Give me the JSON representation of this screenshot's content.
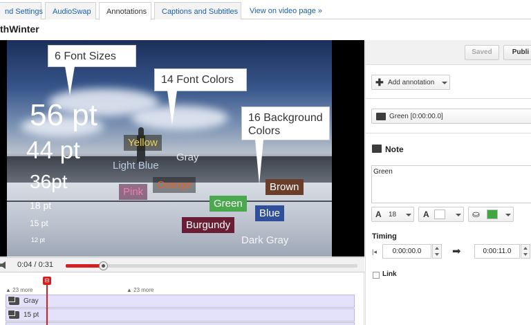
{
  "tabs": [
    {
      "label": "nd Settings"
    },
    {
      "label": "AudioSwap"
    },
    {
      "label": "Annotations"
    },
    {
      "label": "Captions and Subtitles"
    },
    {
      "label": "View on video page »"
    }
  ],
  "video_title": "thWinter",
  "video": {
    "callouts": {
      "font_sizes": "6 Font Sizes",
      "font_colors": "14 Font Colors",
      "background_colors": "16 Background Colors"
    },
    "sizes": [
      "56 pt",
      "44 pt",
      "36pt",
      "18 pt",
      "15 pt",
      "12 pt"
    ],
    "colors": {
      "yellow": "Yellow",
      "gray": "Gray",
      "light_blue": "Light Blue",
      "orange": "Orange",
      "pink": "Pink",
      "green": "Green",
      "brown": "Brown",
      "blue": "Blue",
      "burgundy": "Burgundy",
      "dark_gray": "Dark Gray"
    },
    "label_colors": {
      "yellow_text": "#e8d24a",
      "light_blue_text": "#b9cde2",
      "orange_text": "#e0642a",
      "pink_text": "#e780b0",
      "green_bg": "#4aa84e",
      "brown_bg": "#6b3e2a",
      "blue_bg": "#2f4f9a",
      "burgundy_bg": "#6c1d36"
    }
  },
  "player": {
    "time": "0:04 / 0:31",
    "progress_fraction": 0.129
  },
  "timeline": {
    "more1": "▲ 23 more",
    "more2": "▲ 23 more",
    "tracks": [
      "Gray",
      "15 pt"
    ]
  },
  "panel": {
    "saved": "Saved",
    "publish": "Publi",
    "add_annotation": "Add annotation",
    "selected_annotation": "Green [0:00:00.0]",
    "type": "Note",
    "text_value": "Green",
    "font_size": "18",
    "timing_label": "Timing",
    "start": "0:00:00.0",
    "end": "0:00:11.0",
    "link_label": "Link",
    "bg_color": "#3fa83f"
  }
}
